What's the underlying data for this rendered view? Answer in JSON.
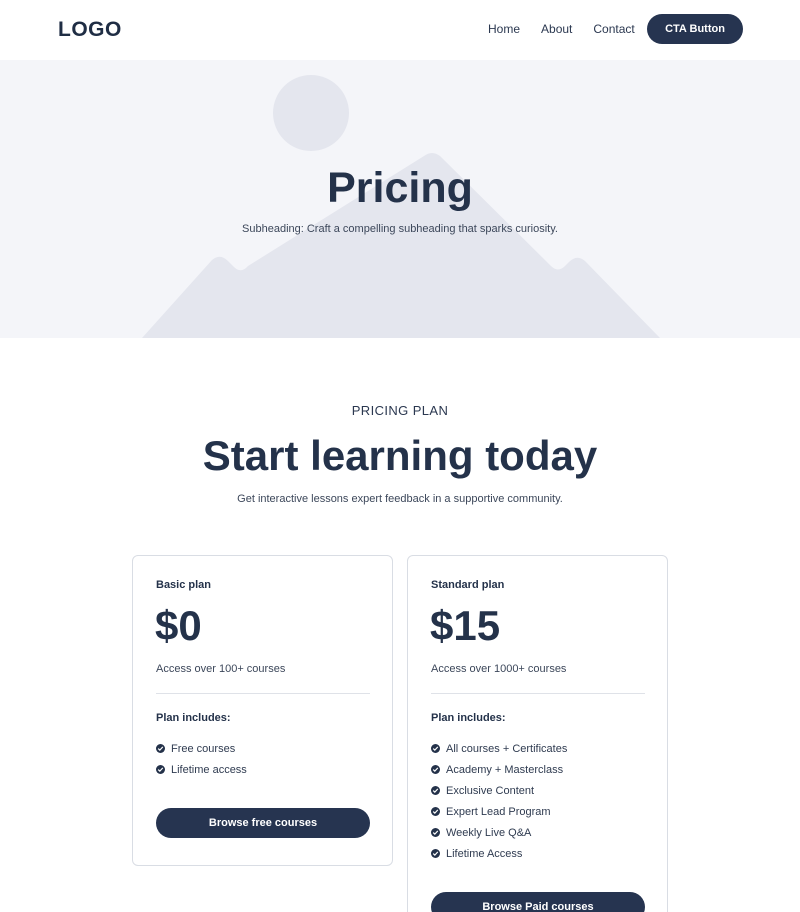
{
  "header": {
    "logo": "LOGO",
    "nav": [
      "Home",
      "About",
      "Contact"
    ],
    "cta_label": "CTA Button"
  },
  "hero": {
    "title": "Pricing",
    "subheading": "Subheading: Craft a compelling subheading that sparks curiosity.",
    "background_icon": "image-placeholder-icon"
  },
  "pricing": {
    "eyebrow": "PRICING PLAN",
    "title": "Start learning today",
    "description": "Get interactive lessons expert feedback in a supportive community.",
    "plans": [
      {
        "name": "Basic plan",
        "price": "$0",
        "description": "Access over 100+ courses",
        "includes_label": "Plan includes:",
        "features": [
          "Free courses",
          "Lifetime access"
        ],
        "button_label": "Browse free courses"
      },
      {
        "name": "Standard plan",
        "price": "$15",
        "description": "Access over 1000+ courses",
        "includes_label": "Plan includes:",
        "features": [
          "All courses + Certificates",
          "Academy + Masterclass",
          "Exclusive Content",
          "Expert Lead Program",
          "Weekly Live Q&A",
          "Lifetime Access"
        ],
        "button_label": "Browse Paid courses"
      }
    ]
  },
  "colors": {
    "primary": "#263450",
    "text": "#24324a",
    "hero_bg": "#f4f5f9",
    "placeholder": "#e4e6ee"
  }
}
